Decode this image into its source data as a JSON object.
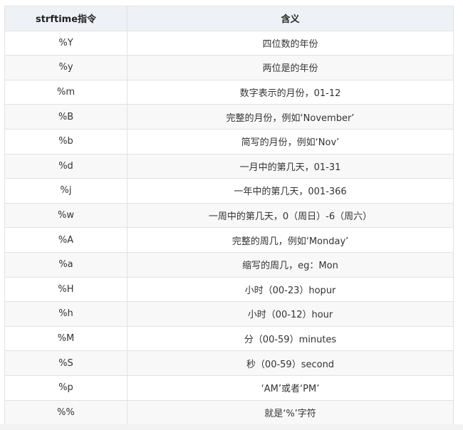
{
  "table": {
    "headers": [
      "strftime指令",
      "含义"
    ],
    "rows": [
      {
        "directive": "%Y",
        "meaning": "四位数的年份"
      },
      {
        "directive": "%y",
        "meaning": "两位是的年份"
      },
      {
        "directive": "%m",
        "meaning": "数字表示的月份，01-12"
      },
      {
        "directive": "%B",
        "meaning": "完整的月份，例如‘November’"
      },
      {
        "directive": "%b",
        "meaning": "简写的月份，例如‘Nov’"
      },
      {
        "directive": "%d",
        "meaning": "一月中的第几天，01-31"
      },
      {
        "directive": "%j",
        "meaning": "一年中的第几天，001-366"
      },
      {
        "directive": "%w",
        "meaning": "一周中的第几天，0（周日）-6（周六）"
      },
      {
        "directive": "%A",
        "meaning": "完整的周几，例如‘Monday’"
      },
      {
        "directive": "%a",
        "meaning": "缩写的周几，eg：Mon"
      },
      {
        "directive": "%H",
        "meaning": "小时（00-23）hopur"
      },
      {
        "directive": "%h",
        "meaning": "小时（00-12）hour"
      },
      {
        "directive": "%M",
        "meaning": "分（00-59）minutes"
      },
      {
        "directive": "%S",
        "meaning": "秒（00-59）second"
      },
      {
        "directive": "%p",
        "meaning": "‘AM’或者‘PM’"
      },
      {
        "directive": "%%",
        "meaning": "就是‘%’字符"
      }
    ]
  }
}
